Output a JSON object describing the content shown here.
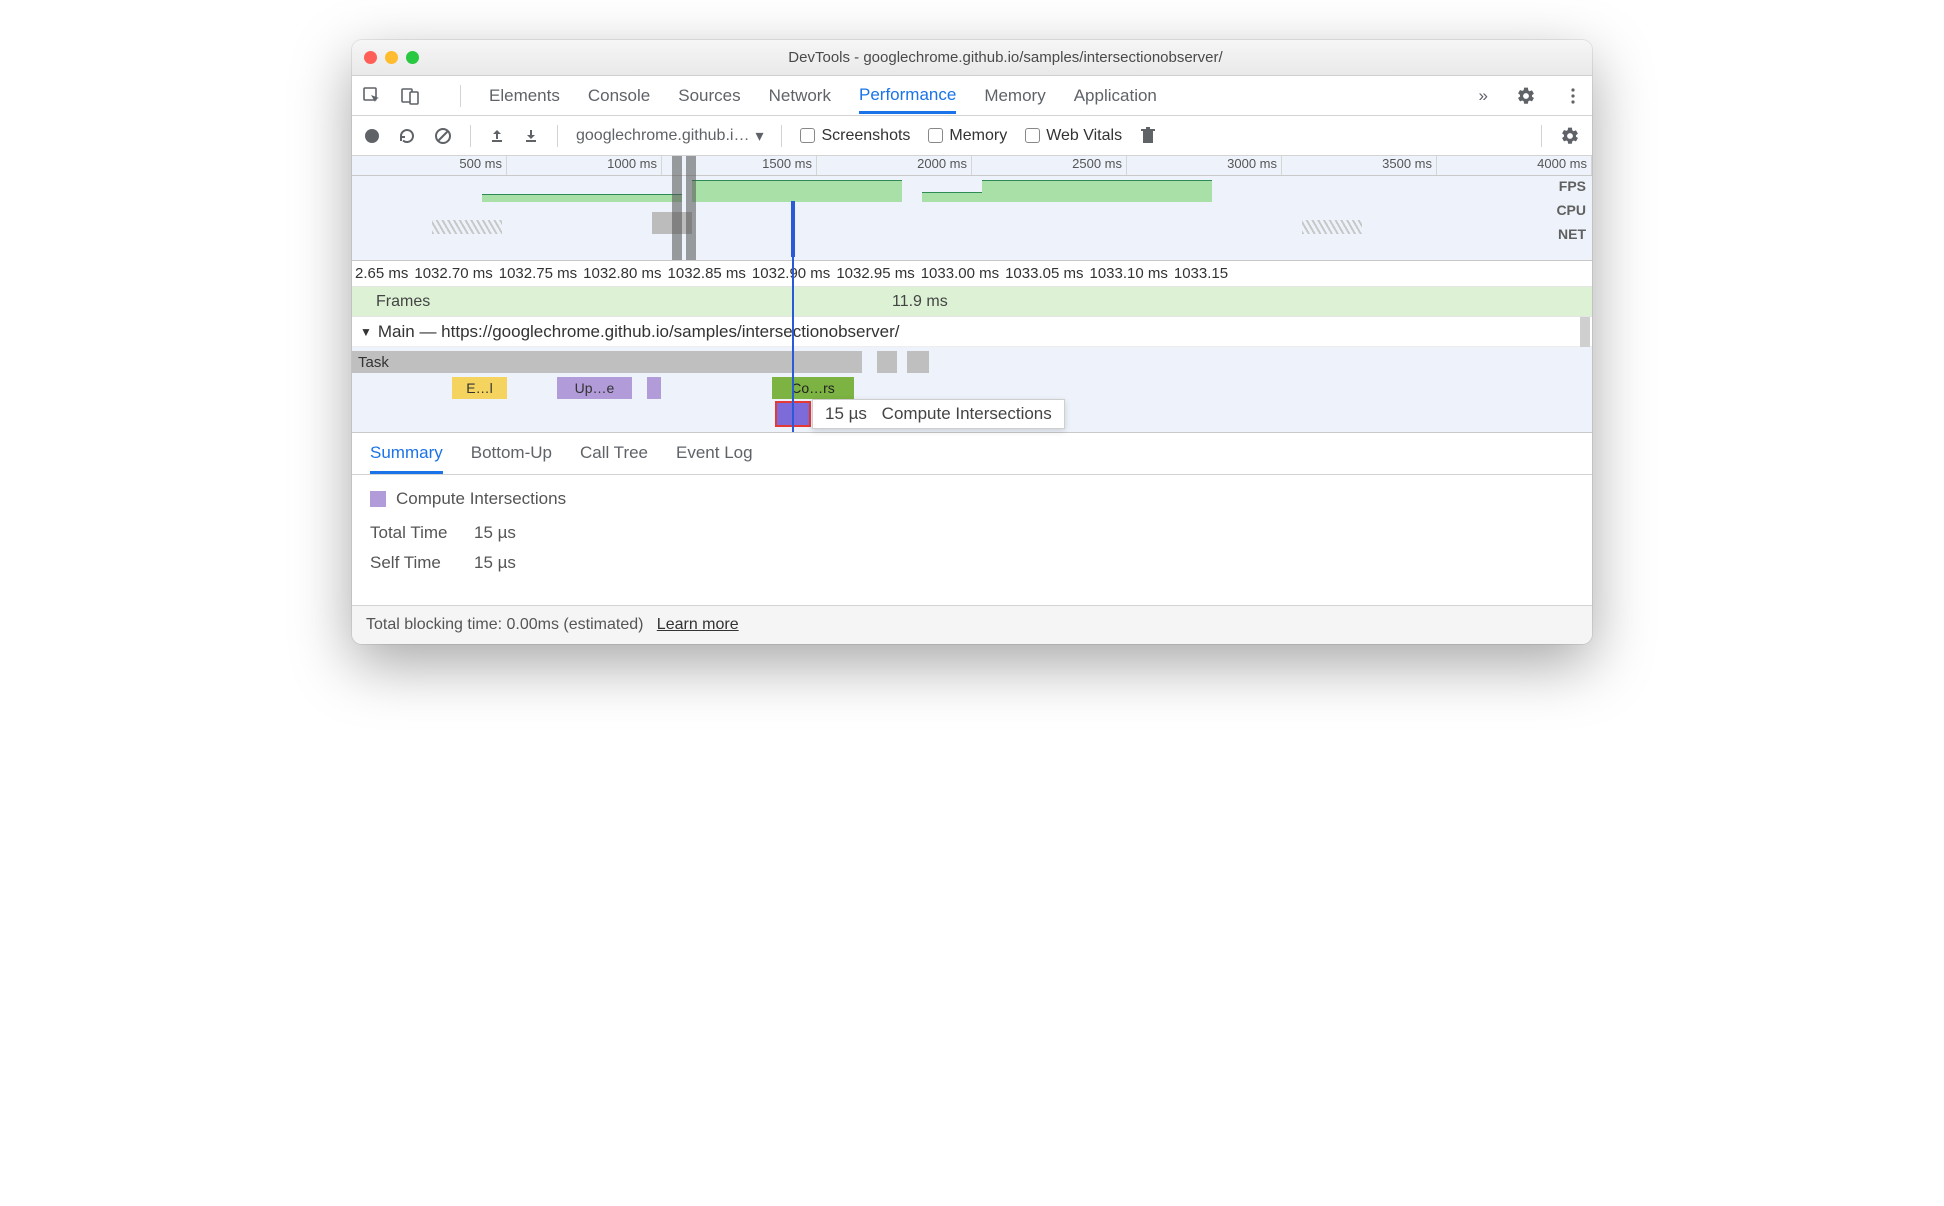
{
  "window": {
    "title": "DevTools - googlechrome.github.io/samples/intersectionobserver/"
  },
  "tabs": {
    "items": [
      "Elements",
      "Console",
      "Sources",
      "Network",
      "Performance",
      "Memory",
      "Application"
    ],
    "active": "Performance",
    "more": "»"
  },
  "toolbar": {
    "url": "googlechrome.github.i…",
    "screenshots": "Screenshots",
    "memory": "Memory",
    "webvitals": "Web Vitals"
  },
  "overview": {
    "ticks": [
      "500 ms",
      "1000 ms",
      "1500 ms",
      "2000 ms",
      "2500 ms",
      "3000 ms",
      "3500 ms",
      "4000 ms"
    ],
    "labels": {
      "fps": "FPS",
      "cpu": "CPU",
      "net": "NET"
    }
  },
  "detail_ruler": [
    "2.65 ms",
    "1032.70 ms",
    "1032.75 ms",
    "1032.80 ms",
    "1032.85 ms",
    "1032.90 ms",
    "1032.95 ms",
    "1033.00 ms",
    "1033.05 ms",
    "1033.10 ms",
    "1033.15"
  ],
  "frames": {
    "label": "Frames",
    "value": "11.9 ms"
  },
  "main": {
    "header": "Main — https://googlechrome.github.io/samples/intersectionobserver/"
  },
  "flame": {
    "task": "Task",
    "e1": "E…l",
    "e2": "Up…e",
    "e3": "Co…rs"
  },
  "tooltip": {
    "duration": "15 µs",
    "name": "Compute Intersections"
  },
  "detail_tabs": [
    "Summary",
    "Bottom-Up",
    "Call Tree",
    "Event Log"
  ],
  "summary": {
    "title": "Compute Intersections",
    "total_label": "Total Time",
    "total_value": "15 µs",
    "self_label": "Self Time",
    "self_value": "15 µs"
  },
  "footer": {
    "text": "Total blocking time: 0.00ms (estimated)",
    "link": "Learn more"
  }
}
